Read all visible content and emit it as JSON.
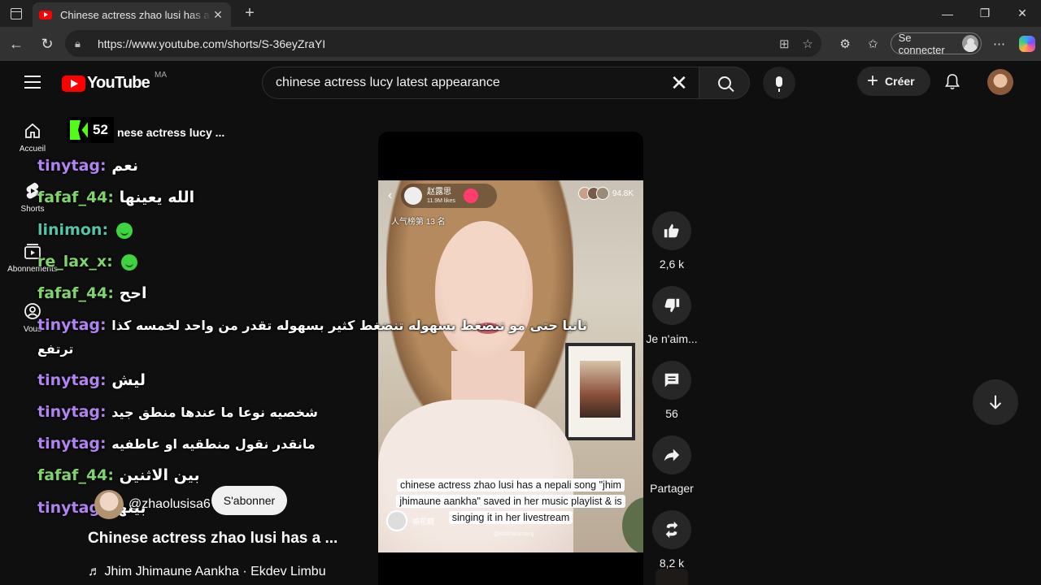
{
  "browser": {
    "tab_title": "Chinese actress zhao lusi has a nepali song",
    "url": "https://www.youtube.com/shorts/S-36eyZraYI",
    "signin_label": "Se connecter"
  },
  "youtube": {
    "logo_text": "YouTube",
    "country_code": "MA",
    "search_query": "chinese actress lucy latest appearance",
    "create_label": "Créer"
  },
  "sidebar": {
    "items": [
      {
        "label": "Accueil",
        "icon": "home-icon"
      },
      {
        "label": "Shorts",
        "icon": "shorts-icon"
      },
      {
        "label": "Abonnements",
        "icon": "subscriptions-icon"
      },
      {
        "label": "Vous",
        "icon": "you-icon"
      }
    ]
  },
  "overlay": {
    "kick_count": "52",
    "title_fragment": "nese actress lucy ...",
    "chat": [
      {
        "user": "tinytag:",
        "msg": "نعم",
        "color": "#b083f0"
      },
      {
        "user": "fafaf_44:",
        "msg": "الله يعينها",
        "color": "#7fd46b"
      },
      {
        "user": "linimon:",
        "msg": "",
        "color": "#53c6a7",
        "emote": true
      },
      {
        "user": "re_lax_x:",
        "msg": "",
        "color": "#7fd46b",
        "emote": true
      },
      {
        "user": "fafaf_44:",
        "msg": "احح",
        "color": "#7fd46b"
      },
      {
        "user": "tinytag:",
        "msg": "ثانيا حتى مو تنضغط بسهوله تنضغط كثير بسهوله تقدر من واحد لخمسه كذا",
        "color": "#b083f0"
      },
      {
        "user": "",
        "msg": "ترتفع",
        "color": "#b083f0"
      },
      {
        "user": "tinytag:",
        "msg": "ليش",
        "color": "#b083f0"
      },
      {
        "user": "tinytag:",
        "msg": "شخصيه نوعا ما عندها منطق جيد",
        "color": "#b083f0"
      },
      {
        "user": "tinytag:",
        "msg": "مانقدر نقول منطقيه او عاطفيه",
        "color": "#b083f0"
      },
      {
        "user": "fafaf_44:",
        "msg": "بين الاثنين",
        "color": "#7fd46b"
      },
      {
        "user": "tinytag:",
        "msg": "بينها",
        "color": "#b083f0"
      }
    ]
  },
  "video": {
    "streamer_name": "赵露思",
    "streamer_likes": "11.9M likes",
    "viewers": "94.8K",
    "rank": "人气榜第 13 名",
    "caption": "chinese actress zhao lusi has a nepali song \"jhim jhimaune aankha\" saved in her music playlist & is singing it in her livestream",
    "bottom_user": "棉花糖",
    "watermark": "@sobhatamang",
    "channel": "@zhaolusisa6",
    "subscribe_label": "S'abonner",
    "title": "Chinese actress zhao lusi has a ...",
    "music": "Jhim Jhimaune Aankha · Ekdev Limbu"
  },
  "actions": {
    "likes": "2,6 k",
    "dislike": "Je n'aim...",
    "comments": "56",
    "share": "Partager",
    "remix": "8,2 k"
  }
}
